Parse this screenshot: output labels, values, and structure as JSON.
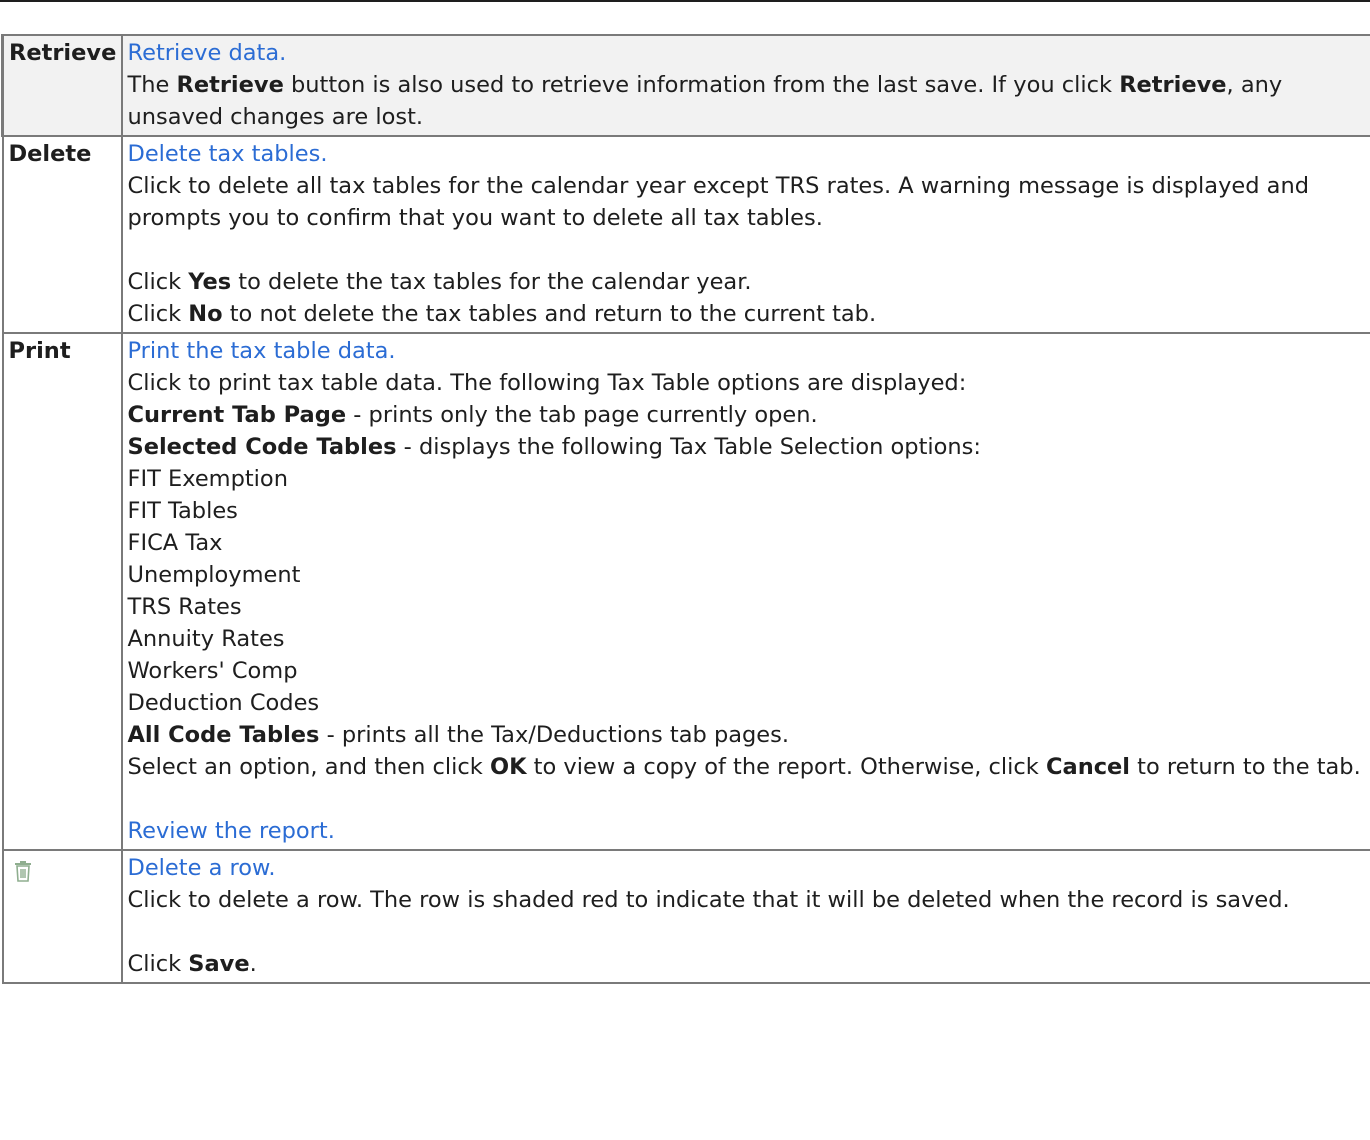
{
  "rows": [
    {
      "label": "Retrieve",
      "link": "Retrieve data.",
      "text1a": "The ",
      "text1b": "Retrieve",
      "text1c": " button is also used to retrieve information from the last save. If you click ",
      "text1d": "Retrieve",
      "text1e": ", any unsaved changes are lost."
    },
    {
      "label": "Delete",
      "link": "Delete tax tables.",
      "text1": "Click to delete all tax tables for the calendar year except TRS rates. A warning message is displayed and prompts you to confirm that you want to delete all tax tables.",
      "yes_a": "Click ",
      "yes_b": "Yes",
      "yes_c": " to delete the tax tables for the calendar year.",
      "no_a": "Click ",
      "no_b": "No",
      "no_c": " to not delete the tax tables and return to the current tab."
    },
    {
      "label": "Print",
      "link": "Print the tax table data.",
      "intro": "Click to print tax table data. The following Tax Table options are displayed:",
      "opt1_b": "Current Tab Page",
      "opt1_t": " - prints only the tab page currently open.",
      "opt2_b": "Selected Code Tables",
      "opt2_t": " - displays the following Tax Table Selection options:",
      "tables": [
        "FIT Exemption",
        "FIT Tables",
        "FICA Tax",
        "Unemployment",
        "TRS Rates",
        "Annuity Rates",
        "Workers' Comp",
        "Deduction Codes"
      ],
      "opt3_b": "All Code Tables",
      "opt3_t": " - prints all the Tax/Deductions tab pages.",
      "sel_a": "Select an option, and then click ",
      "sel_b": "OK",
      "sel_c": " to view a copy of the report. Otherwise, click ",
      "sel_d": "Cancel",
      "sel_e": " to return to the tab.",
      "review_link": "Review the report."
    },
    {
      "icon": "trash-icon",
      "link": "Delete a row.",
      "text1": "Click to delete a row. The row is shaded red to indicate that it will be deleted when the record is saved.",
      "save_a": "Click ",
      "save_b": "Save",
      "save_c": "."
    }
  ],
  "colors": {
    "link": "#2b6cd4",
    "border": "#7a7a7a",
    "header_bg": "#f2f2f2",
    "icon": "#8fae8f"
  }
}
